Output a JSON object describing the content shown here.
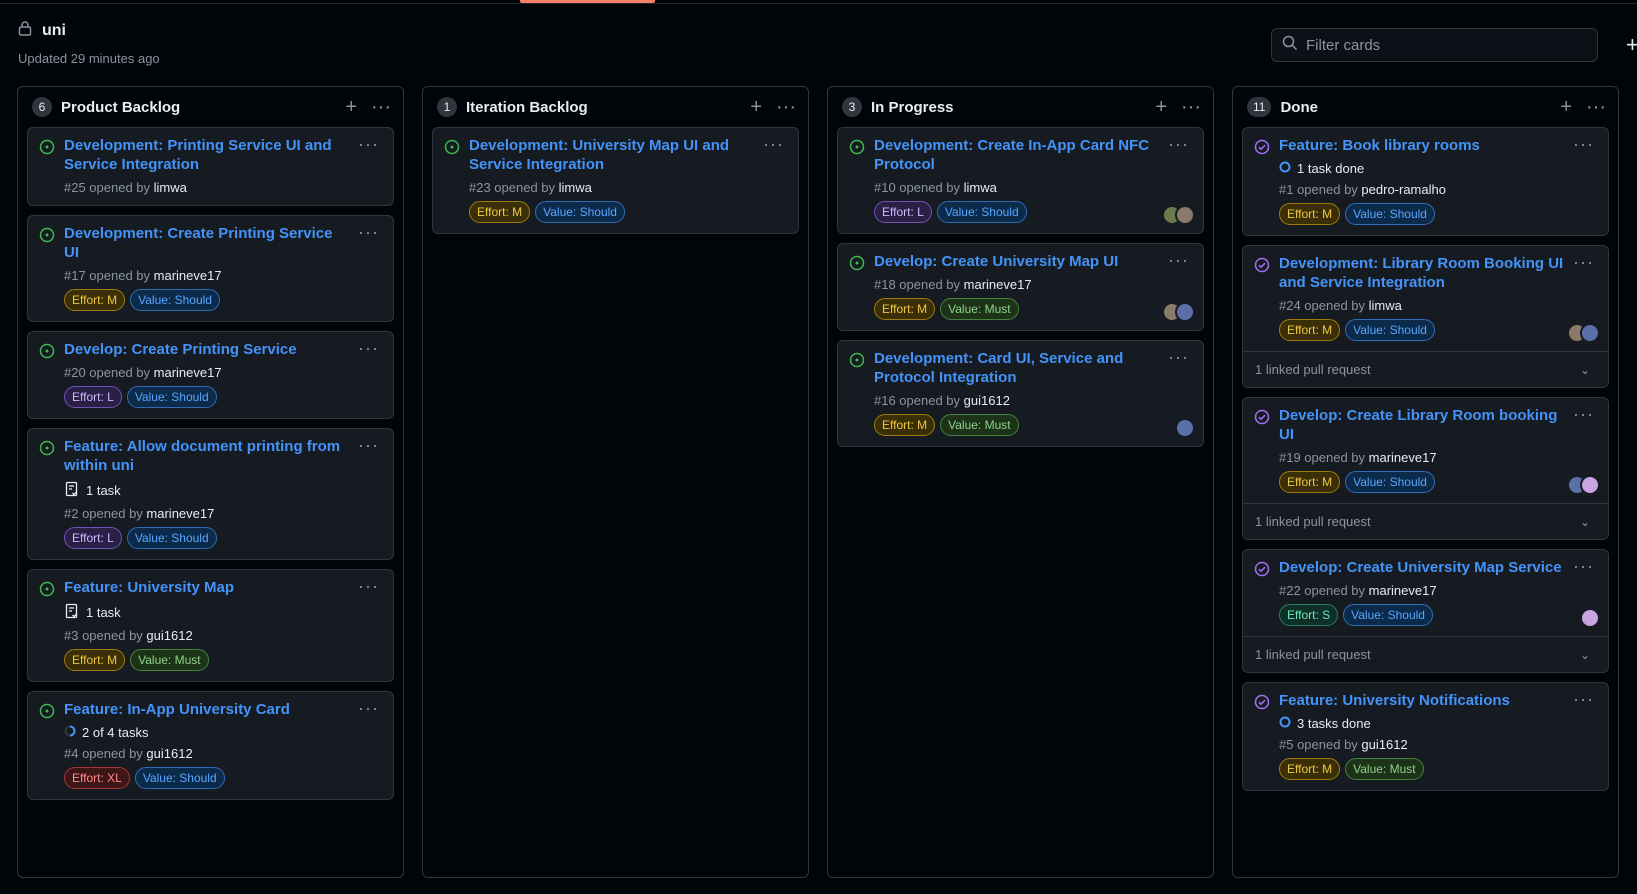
{
  "project": {
    "name": "uni",
    "updated": "Updated 29 minutes ago"
  },
  "filter": {
    "placeholder": "Filter cards"
  },
  "columns": [
    {
      "count": "6",
      "title": "Product Backlog",
      "cards": [
        {
          "title": "Development: Printing Service UI and Service Integration",
          "meta_prefix": "#25 opened by",
          "author": "limwa",
          "labels": []
        },
        {
          "title": "Development: Create Printing Service UI",
          "meta_prefix": "#17 opened by",
          "author": "marineve17",
          "labels": [
            "Effort: M",
            "Value: Should"
          ]
        },
        {
          "title": "Develop: Create Printing Service",
          "meta_prefix": "#20 opened by",
          "author": "marineve17",
          "labels": [
            "Effort: L",
            "Value: Should"
          ]
        },
        {
          "title": "Feature: Allow document printing from within uni",
          "task": "1 task",
          "meta_prefix": "#2 opened by",
          "author": "marineve17",
          "labels": [
            "Effort: L",
            "Value: Should"
          ]
        },
        {
          "title": "Feature: University Map",
          "task": "1 task",
          "meta_prefix": "#3 opened by",
          "author": "gui1612",
          "labels": [
            "Effort: M",
            "Value: Must"
          ]
        },
        {
          "title": "Feature: In-App University Card",
          "task": "2 of 4 tasks",
          "meta_prefix": "#4 opened by",
          "author": "gui1612",
          "labels": [
            "Effort: XL",
            "Value: Should"
          ]
        }
      ]
    },
    {
      "count": "1",
      "title": "Iteration Backlog",
      "cards": [
        {
          "title": "Development: University Map UI and Service Integration",
          "meta_prefix": "#23 opened by",
          "author": "limwa",
          "labels": [
            "Effort: M",
            "Value: Should"
          ]
        }
      ]
    },
    {
      "count": "3",
      "title": "In Progress",
      "cards": [
        {
          "title": "Development: Create In-App Card NFC Protocol",
          "meta_prefix": "#10 opened by",
          "author": "limwa",
          "labels": [
            "Effort: L",
            "Value: Should"
          ]
        },
        {
          "title": "Develop: Create University Map UI",
          "meta_prefix": "#18 opened by",
          "author": "marineve17",
          "labels": [
            "Effort: M",
            "Value: Must"
          ]
        },
        {
          "title": "Development: Card UI, Service and Protocol Integration",
          "meta_prefix": "#16 opened by",
          "author": "gui1612",
          "labels": [
            "Effort: M",
            "Value: Must"
          ]
        }
      ]
    },
    {
      "count": "11",
      "title": "Done",
      "cards": [
        {
          "title": "Feature: Book library rooms",
          "task": "1 task done",
          "meta_prefix": "#1 opened by",
          "author": "pedro-ramalho",
          "labels": [
            "Effort: M",
            "Value: Should"
          ]
        },
        {
          "title": "Development: Library Room Booking UI and Service Integration",
          "meta_prefix": "#24 opened by",
          "author": "limwa",
          "labels": [
            "Effort: M",
            "Value: Should"
          ],
          "linked": "1 linked pull request"
        },
        {
          "title": "Develop: Create Library Room booking UI",
          "meta_prefix": "#19 opened by",
          "author": "marineve17",
          "labels": [
            "Effort: M",
            "Value: Should"
          ],
          "linked": "1 linked pull request"
        },
        {
          "title": "Develop: Create University Map Service",
          "meta_prefix": "#22 opened by",
          "author": "marineve17",
          "labels": [
            "Effort: S",
            "Value: Should"
          ],
          "linked": "1 linked pull request"
        },
        {
          "title": "Feature: University Notifications",
          "task": "3 tasks done",
          "meta_prefix": "#5 opened by",
          "author": "gui1612",
          "labels": [
            "Effort: M",
            "Value: Must"
          ]
        }
      ]
    }
  ],
  "colors": {
    "open": "#3fb950",
    "closed": "#a371f7",
    "link": "#4493f8",
    "accent": "#f78166"
  }
}
